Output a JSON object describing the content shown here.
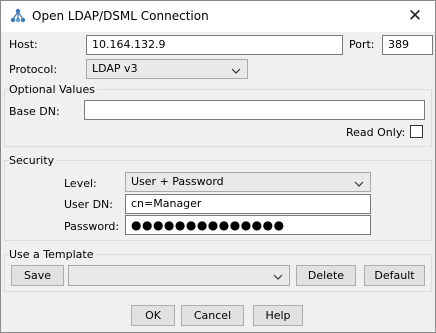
{
  "window": {
    "title": "Open LDAP/DSML Connection",
    "close_glyph": "✕",
    "app_icon": "tree-icon"
  },
  "connection": {
    "host_label": "Host:",
    "host_value": "10.164.132.9",
    "port_label": "Port:",
    "port_value": "389",
    "protocol_label": "Protocol:",
    "protocol_value": "LDAP v3"
  },
  "optional": {
    "section_label": "Optional Values",
    "base_dn_label": "Base DN:",
    "base_dn_value": "",
    "read_only_label": "Read Only:",
    "read_only_checked": false
  },
  "security": {
    "section_label": "Security",
    "level_label": "Level:",
    "level_value": "User + Password",
    "user_dn_label": "User DN:",
    "user_dn_value": "cn=Manager",
    "password_label": "Password:",
    "password_value": "●●●●●●●●●●●●●●"
  },
  "template": {
    "section_label": "Use a Template",
    "save_label": "Save",
    "template_value": "",
    "delete_label": "Delete",
    "default_label": "Default"
  },
  "footer": {
    "ok_label": "OK",
    "cancel_label": "Cancel",
    "help_label": "Help"
  }
}
